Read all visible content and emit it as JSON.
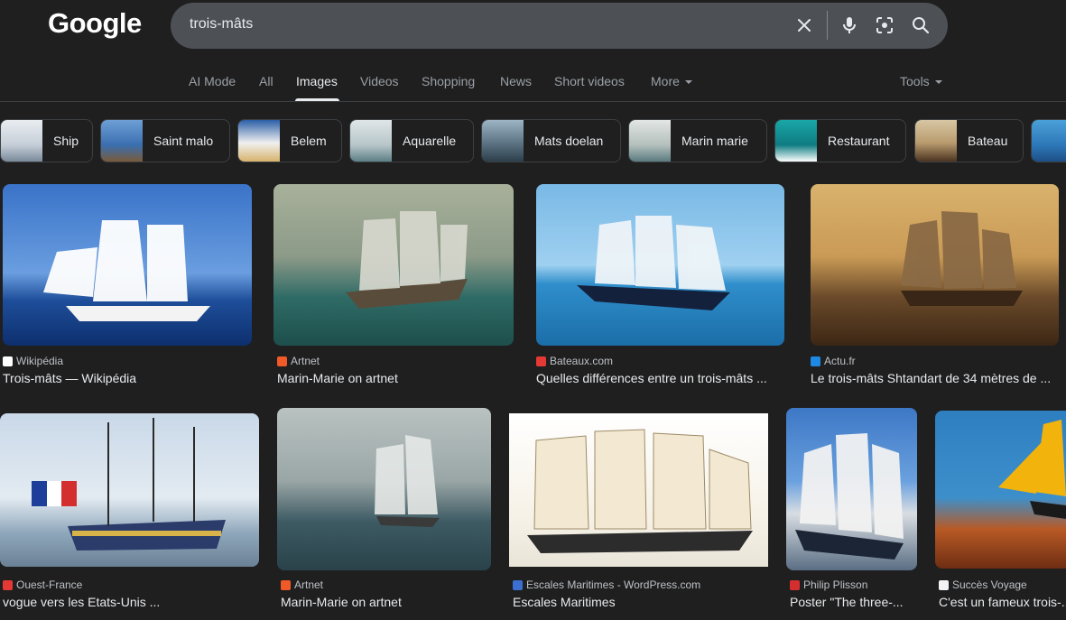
{
  "logo": "Google",
  "search": {
    "query": "trois-mâts"
  },
  "nav": {
    "tabs": [
      "AI Mode",
      "All",
      "Images",
      "Videos",
      "Shopping",
      "News",
      "Short videos",
      "More"
    ],
    "active": "Images",
    "tools": "Tools"
  },
  "chips": [
    "Ship",
    "Saint malo",
    "Belem",
    "Aquarelle",
    "Mats doelan",
    "Marin marie",
    "Restaurant",
    "Bateau"
  ],
  "results": [
    {
      "source": "Wikipédia",
      "title": "Trois-mâts — Wikipédia",
      "favicon_color": "#ffffff"
    },
    {
      "source": "Artnet",
      "title": "Marin-Marie on artnet",
      "favicon_color": "#f05a28"
    },
    {
      "source": "Bateaux.com",
      "title": "Quelles différences entre un trois-mâts ...",
      "favicon_color": "#e53935"
    },
    {
      "source": "Actu.fr",
      "title": "Le trois-mâts Shtandart de 34 mètres de ...",
      "favicon_color": "#1e88e5"
    },
    {
      "source": "Ouest-France",
      "title": "vogue vers les Etats-Unis ...",
      "favicon_color": "#e53935"
    },
    {
      "source": "Artnet",
      "title": "Marin-Marie on artnet",
      "favicon_color": "#f05a28"
    },
    {
      "source": "Escales Maritimes - WordPress.com",
      "title": "Escales Maritimes",
      "favicon_color": "#3b6fd1"
    },
    {
      "source": "Philip Plisson",
      "title": "Poster \"The three-...",
      "favicon_color": "#d32f2f"
    },
    {
      "source": "Succès Voyage",
      "title": "C'est un fameux trois-...",
      "favicon_color": "#f1f3f4"
    }
  ],
  "colors": {
    "background": "#1f1f1f",
    "searchbox": "#4d5156",
    "text": "#e8eaed",
    "muted": "#9aa0a6"
  }
}
